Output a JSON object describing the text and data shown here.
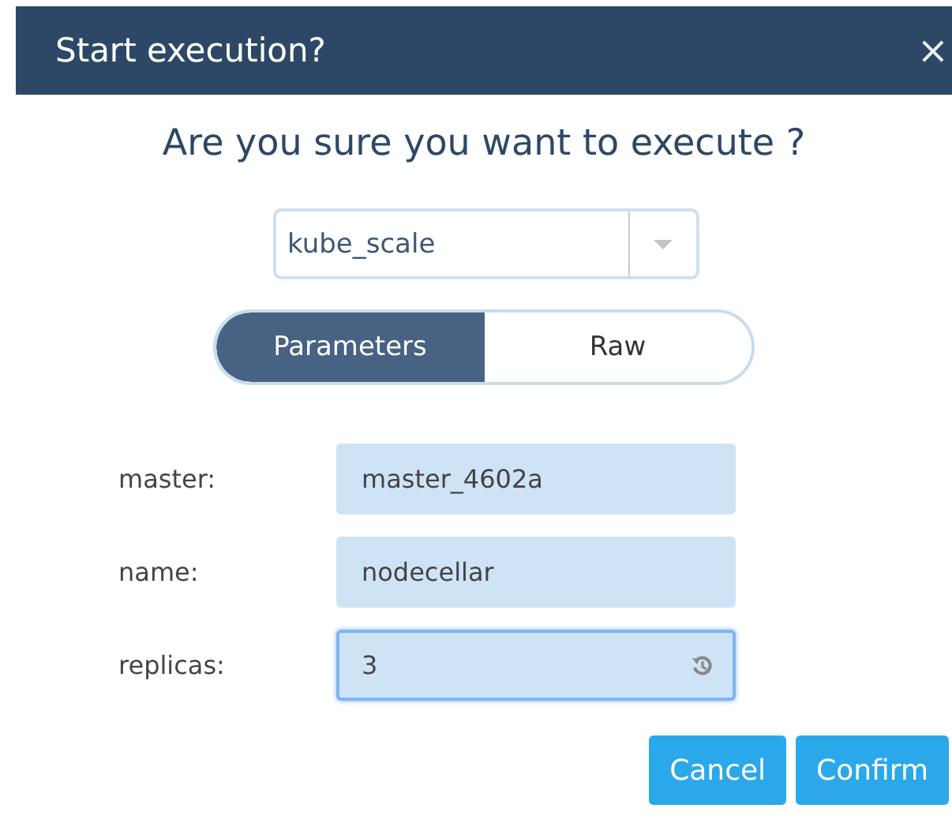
{
  "dialog": {
    "title": "Start execution?",
    "close": "×"
  },
  "heading": "Are you sure you want to execute ?",
  "workflow_select": {
    "value": "kube_scale"
  },
  "tabs": [
    {
      "label": "Parameters",
      "selected": true
    },
    {
      "label": "Raw",
      "selected": false
    }
  ],
  "fields": [
    {
      "label": "master:",
      "value": "master_4602a",
      "focused": false,
      "reset_icon": false
    },
    {
      "label": "name:",
      "value": "nodecellar",
      "focused": false,
      "reset_icon": false
    },
    {
      "label": "replicas:",
      "value": "3",
      "focused": true,
      "reset_icon": true
    }
  ],
  "buttons": [
    "Cancel",
    "Confirm"
  ]
}
